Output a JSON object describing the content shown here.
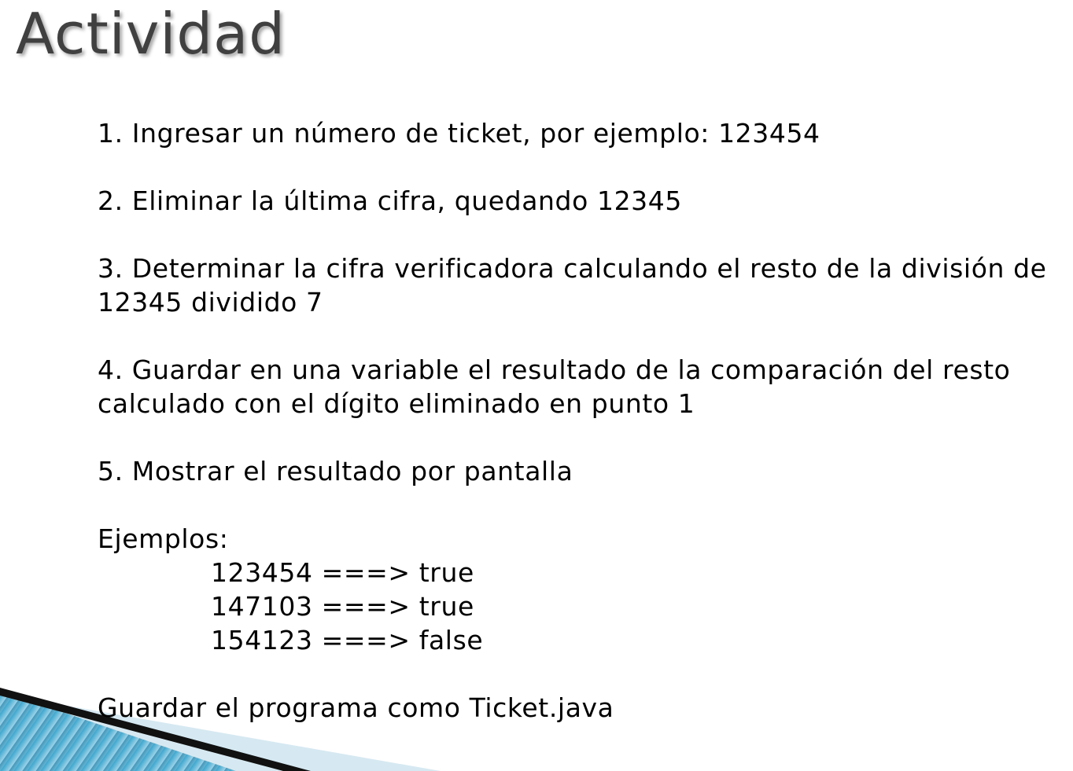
{
  "title": "Actividad",
  "steps": [
    "1.  Ingresar un número de ticket, por ejemplo: 123454",
    "2. Eliminar la última cifra, quedando 12345",
    "3. Determinar la cifra verificadora calculando el resto de la división de 12345 dividido 7",
    "4. Guardar en una variable el resultado de la comparación del resto calculado con el dígito eliminado en punto 1",
    "5. Mostrar el resultado por pantalla"
  ],
  "examples": {
    "label": "Ejemplos:",
    "items": [
      "123454 ===> true",
      "147103 ===> true",
      "154123 ===> false"
    ]
  },
  "footer": "Guardar el programa como Ticket.java",
  "colors": {
    "title": "#404040",
    "text": "#000000",
    "accent_blue": "#3a9cc4",
    "accent_light": "#d6e9f2"
  }
}
